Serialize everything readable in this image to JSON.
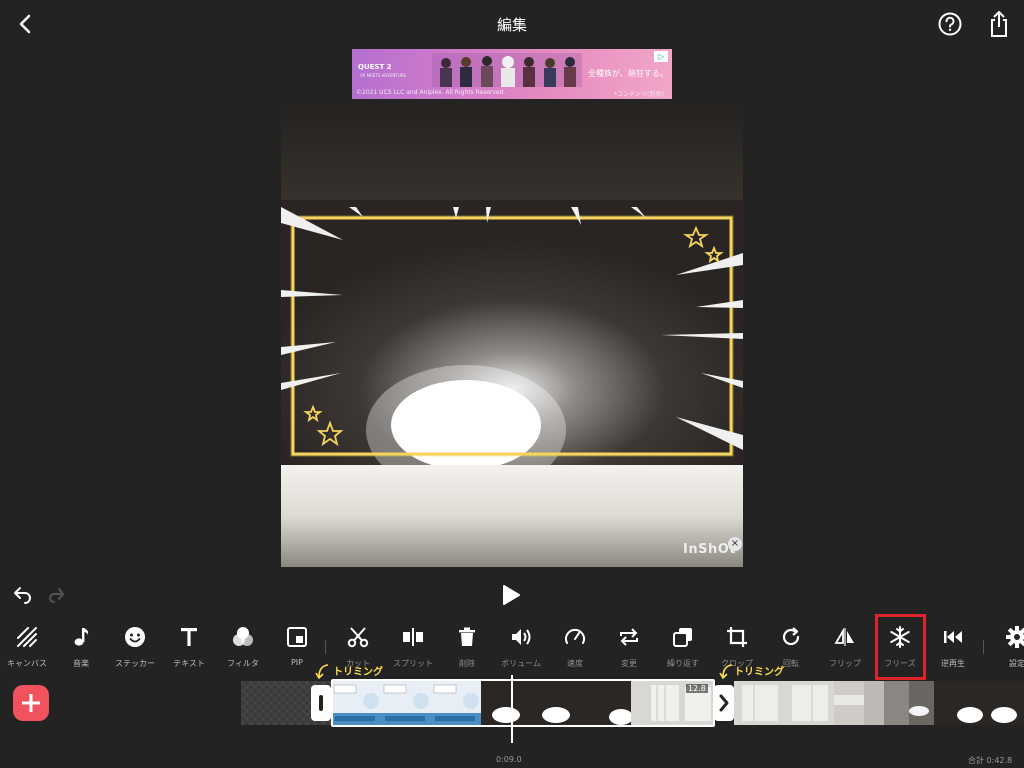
{
  "header": {
    "title": "編集"
  },
  "ad": {
    "brand": "QUEST 2",
    "brand_sub": "VR MEETS ADVENTURE",
    "tagline": "全種族が、熱狂する。",
    "copyright": "©2021 UCS LLC and Aniplex. All Rights Reserved.",
    "note": "*コンテンツ(別売)",
    "badge": "▷"
  },
  "preview": {
    "watermark": "InShOt",
    "watermark_close": "×"
  },
  "toolbar": {
    "items": [
      {
        "label": "キャンバス",
        "icon": "canvas-icon"
      },
      {
        "label": "音楽",
        "icon": "music-note-icon"
      },
      {
        "label": "ステッカー",
        "icon": "smiley-sticker-icon"
      },
      {
        "label": "テキスト",
        "icon": "text-t-icon"
      },
      {
        "label": "フィルタ",
        "icon": "filter-circles-icon"
      },
      {
        "label": "PIP",
        "icon": "pip-icon"
      },
      {
        "label": "カット",
        "icon": "scissors-icon"
      },
      {
        "label": "スプリット",
        "icon": "split-icon"
      },
      {
        "label": "削除",
        "icon": "trash-icon"
      },
      {
        "label": "ボリューム",
        "icon": "volume-icon"
      },
      {
        "label": "速度",
        "icon": "speedometer-icon"
      },
      {
        "label": "変更",
        "icon": "replace-icon"
      },
      {
        "label": "繰り返す",
        "icon": "duplicate-icon"
      },
      {
        "label": "クロップ",
        "icon": "crop-icon"
      },
      {
        "label": "回転",
        "icon": "rotate-icon"
      },
      {
        "label": "フリップ",
        "icon": "flip-icon"
      },
      {
        "label": "フリーズ",
        "icon": "snowflake-icon"
      },
      {
        "label": "逆再生",
        "icon": "reverse-icon"
      },
      {
        "label": "設定",
        "icon": "gear-icon"
      }
    ]
  },
  "timeline": {
    "clip_duration": "12.8",
    "trim_left_label": "トリミング",
    "trim_right_label": "トリミング",
    "current_time": "0:09.0",
    "total_time": "合計 0:42.8",
    "highlight_color": "#e0242b",
    "add_button_color": "#f0525e"
  }
}
